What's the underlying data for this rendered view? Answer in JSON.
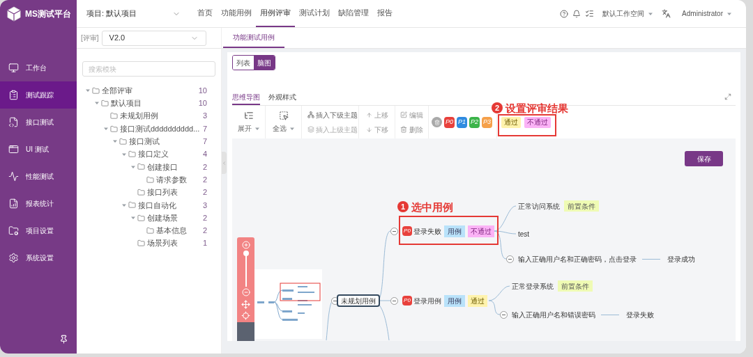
{
  "logo": {
    "text": "MS测试平台"
  },
  "sidebar": {
    "items": [
      {
        "label": "工作台",
        "selected": false
      },
      {
        "label": "测试跟踪",
        "selected": true
      },
      {
        "label": "接口测试",
        "selected": false
      },
      {
        "label": "UI 测试",
        "selected": false
      },
      {
        "label": "性能测试",
        "selected": false
      },
      {
        "label": "报表统计",
        "selected": false
      },
      {
        "label": "项目设置",
        "selected": false
      },
      {
        "label": "系统设置",
        "selected": false
      }
    ]
  },
  "header": {
    "project": "项目: 默认项目",
    "nav": [
      {
        "label": "首页",
        "selected": false
      },
      {
        "label": "功能用例",
        "selected": false
      },
      {
        "label": "用例评审",
        "selected": true
      },
      {
        "label": "测试计划",
        "selected": false
      },
      {
        "label": "缺陷管理",
        "selected": false
      },
      {
        "label": "报告",
        "selected": false
      }
    ],
    "workspace": "默认工作空间",
    "user": "Administrator"
  },
  "review_select": {
    "prefix": "[评审]",
    "value": "V2.0"
  },
  "page_tabs": [
    {
      "label": "功能测试用例",
      "selected": true
    }
  ],
  "module_search": {
    "placeholder": "搜索模块"
  },
  "tree": [
    {
      "label": "全部评审",
      "count": "10",
      "expanded": true,
      "children": [
        {
          "label": "默认项目",
          "count": "10",
          "expanded": true,
          "children": [
            {
              "label": "未规划用例",
              "count": "3"
            },
            {
              "label": "接口测试dddddddddd...",
              "count": "7",
              "expanded": true,
              "children": [
                {
                  "label": "接口测试",
                  "count": "7",
                  "expanded": true,
                  "children": [
                    {
                      "label": "接口定义",
                      "count": "4",
                      "expanded": true,
                      "children": [
                        {
                          "label": "创建接口",
                          "count": "2",
                          "expanded": true,
                          "children": [
                            {
                              "label": "请求参数",
                              "count": "2"
                            }
                          ]
                        },
                        {
                          "label": "接口列表",
                          "count": "2"
                        }
                      ]
                    },
                    {
                      "label": "接口自动化",
                      "count": "3",
                      "expanded": true,
                      "children": [
                        {
                          "label": "创建场景",
                          "count": "2",
                          "expanded": true,
                          "children": [
                            {
                              "label": "基本信息",
                              "count": "2"
                            }
                          ]
                        },
                        {
                          "label": "场景列表",
                          "count": "1"
                        }
                      ]
                    }
                  ]
                }
              ]
            }
          ]
        }
      ]
    }
  ],
  "view_toggle": [
    {
      "label": "列表",
      "selected": false
    },
    {
      "label": "脑图",
      "selected": true
    }
  ],
  "editor_tabs": [
    {
      "label": "思维导图",
      "selected": true
    },
    {
      "label": "外观样式",
      "selected": false
    }
  ],
  "toolbar": {
    "expand": "展开",
    "select_all": "全选",
    "insert_child": "插入下级主题",
    "insert_parent": "插入上级主题",
    "move_up": "上移",
    "move_down": "下移",
    "edit": "编辑",
    "delete": "删除",
    "priorities": [
      {
        "label": "P0",
        "color": "#e8413c"
      },
      {
        "label": "P1",
        "color": "#2f8be0"
      },
      {
        "label": "P2",
        "color": "#3cb44a"
      },
      {
        "label": "P3",
        "color": "#f5a04a"
      }
    ],
    "results": [
      {
        "label": "通过",
        "kind": "pass"
      },
      {
        "label": "不通过",
        "kind": "fail"
      }
    ],
    "annotation": {
      "number": "2",
      "text": "设置评审结果"
    }
  },
  "mindmap": {
    "save": "保存",
    "annotation": {
      "number": "1",
      "text": "选中用例"
    },
    "zoom": {
      "level": 1
    },
    "root": "未规划用例",
    "cases": [
      {
        "priority": {
          "label": "P0",
          "color": "#e8413c"
        },
        "title": "登录失败",
        "tag": "用例",
        "result": {
          "label": "不通过",
          "kind": "fail"
        },
        "steps": [
          {
            "text": "正常访问系统",
            "tag": "前置条件"
          },
          {
            "text": "test"
          },
          {
            "text": "输入正确用户名和正确密码，点击登录",
            "expected": "登录成功"
          }
        ]
      },
      {
        "priority": {
          "label": "P0",
          "color": "#e8413c"
        },
        "title": "登录用例",
        "tag": "用例",
        "result": {
          "label": "通过",
          "kind": "pass"
        },
        "steps": [
          {
            "text": "正常登录系统",
            "tag": "前置条件"
          },
          {
            "text": "输入正确用户名和错误密码",
            "expected": "登录失败"
          }
        ]
      }
    ]
  }
}
